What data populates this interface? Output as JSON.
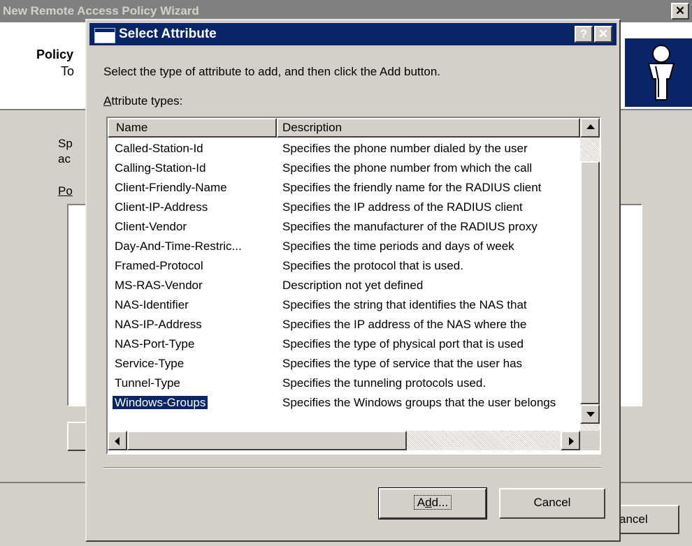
{
  "background_wizard": {
    "title": "New Remote Access Policy Wizard",
    "header_title": "Policy",
    "header_subtitle": "To",
    "body_text_1": "Sp",
    "body_text_2": "ac",
    "list_label": "Po",
    "cancel_label": "ancel"
  },
  "dialog": {
    "title": "Select Attribute",
    "help_button": "?",
    "close_button": "✕",
    "instruction": "Select the type of attribute to add, and then click the Add button.",
    "list_label": "Attribute types:",
    "columns": [
      "Name",
      "Description"
    ],
    "rows": [
      {
        "name": "Called-Station-Id",
        "description": "Specifies the phone number dialed by the user"
      },
      {
        "name": "Calling-Station-Id",
        "description": "Specifies the phone number from which the call"
      },
      {
        "name": "Client-Friendly-Name",
        "description": "Specifies the friendly name for the RADIUS client"
      },
      {
        "name": "Client-IP-Address",
        "description": "Specifies the IP address of the RADIUS client"
      },
      {
        "name": "Client-Vendor",
        "description": "Specifies the manufacturer of the RADIUS proxy"
      },
      {
        "name": "Day-And-Time-Restric...",
        "description": "Specifies the time periods and days of week"
      },
      {
        "name": "Framed-Protocol",
        "description": "Specifies the protocol that is used."
      },
      {
        "name": "MS-RAS-Vendor",
        "description": "Description not yet defined"
      },
      {
        "name": "NAS-Identifier",
        "description": "Specifies the string that identifies the NAS that"
      },
      {
        "name": "NAS-IP-Address",
        "description": "Specifies the IP address of the NAS where the"
      },
      {
        "name": "NAS-Port-Type",
        "description": "Specifies the type of physical port that is used"
      },
      {
        "name": "Service-Type",
        "description": "Specifies the type of service that the user has"
      },
      {
        "name": "Tunnel-Type",
        "description": "Specifies the tunneling protocols used."
      },
      {
        "name": "Windows-Groups",
        "description": "Specifies the Windows groups that the user belongs"
      }
    ],
    "selected_index": 13,
    "add_button": "Add...",
    "cancel_button": "Cancel"
  }
}
